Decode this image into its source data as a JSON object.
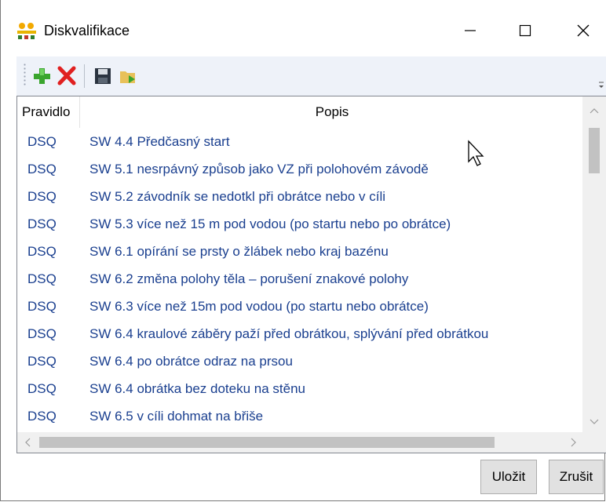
{
  "window": {
    "title": "Diskvalifikace"
  },
  "toolbar": {
    "buttons": [
      "add-icon",
      "delete-icon",
      "save-icon",
      "load-icon"
    ]
  },
  "grid": {
    "columns": [
      "Pravidlo",
      "Popis"
    ],
    "rows": [
      {
        "rule": "DSQ",
        "desc": "SW 4.4 Předčasný start"
      },
      {
        "rule": "DSQ",
        "desc": "SW 5.1 nesrpávný způsob jako VZ při polohovém závodě"
      },
      {
        "rule": "DSQ",
        "desc": "SW 5.2 závodník se nedotkl při obrátce nebo v cíli"
      },
      {
        "rule": "DSQ",
        "desc": "SW 5.3 více než 15 m pod vodou (po startu nebo po obrátce)"
      },
      {
        "rule": "DSQ",
        "desc": "SW 6.1 opírání se prsty o žlábek nebo kraj bazénu"
      },
      {
        "rule": "DSQ",
        "desc": "SW 6.2 změna polohy těla – porušení znakové polohy"
      },
      {
        "rule": "DSQ",
        "desc": "SW 6.3 více než 15m pod vodou (po startu nebo obrátce)"
      },
      {
        "rule": "DSQ",
        "desc": "SW 6.4 kraulové záběry paží před obrátkou, splývání před obrátkou"
      },
      {
        "rule": "DSQ",
        "desc": "SW 6.4 po obrátce odraz na prsou"
      },
      {
        "rule": "DSQ",
        "desc": "SW 6.4 obrátka bez doteku na stěnu"
      },
      {
        "rule": "DSQ",
        "desc": "SW 6.5 v cíli dohmat na břiše"
      }
    ]
  },
  "footer": {
    "save_label": "Uložit",
    "cancel_label": "Zrušit"
  }
}
